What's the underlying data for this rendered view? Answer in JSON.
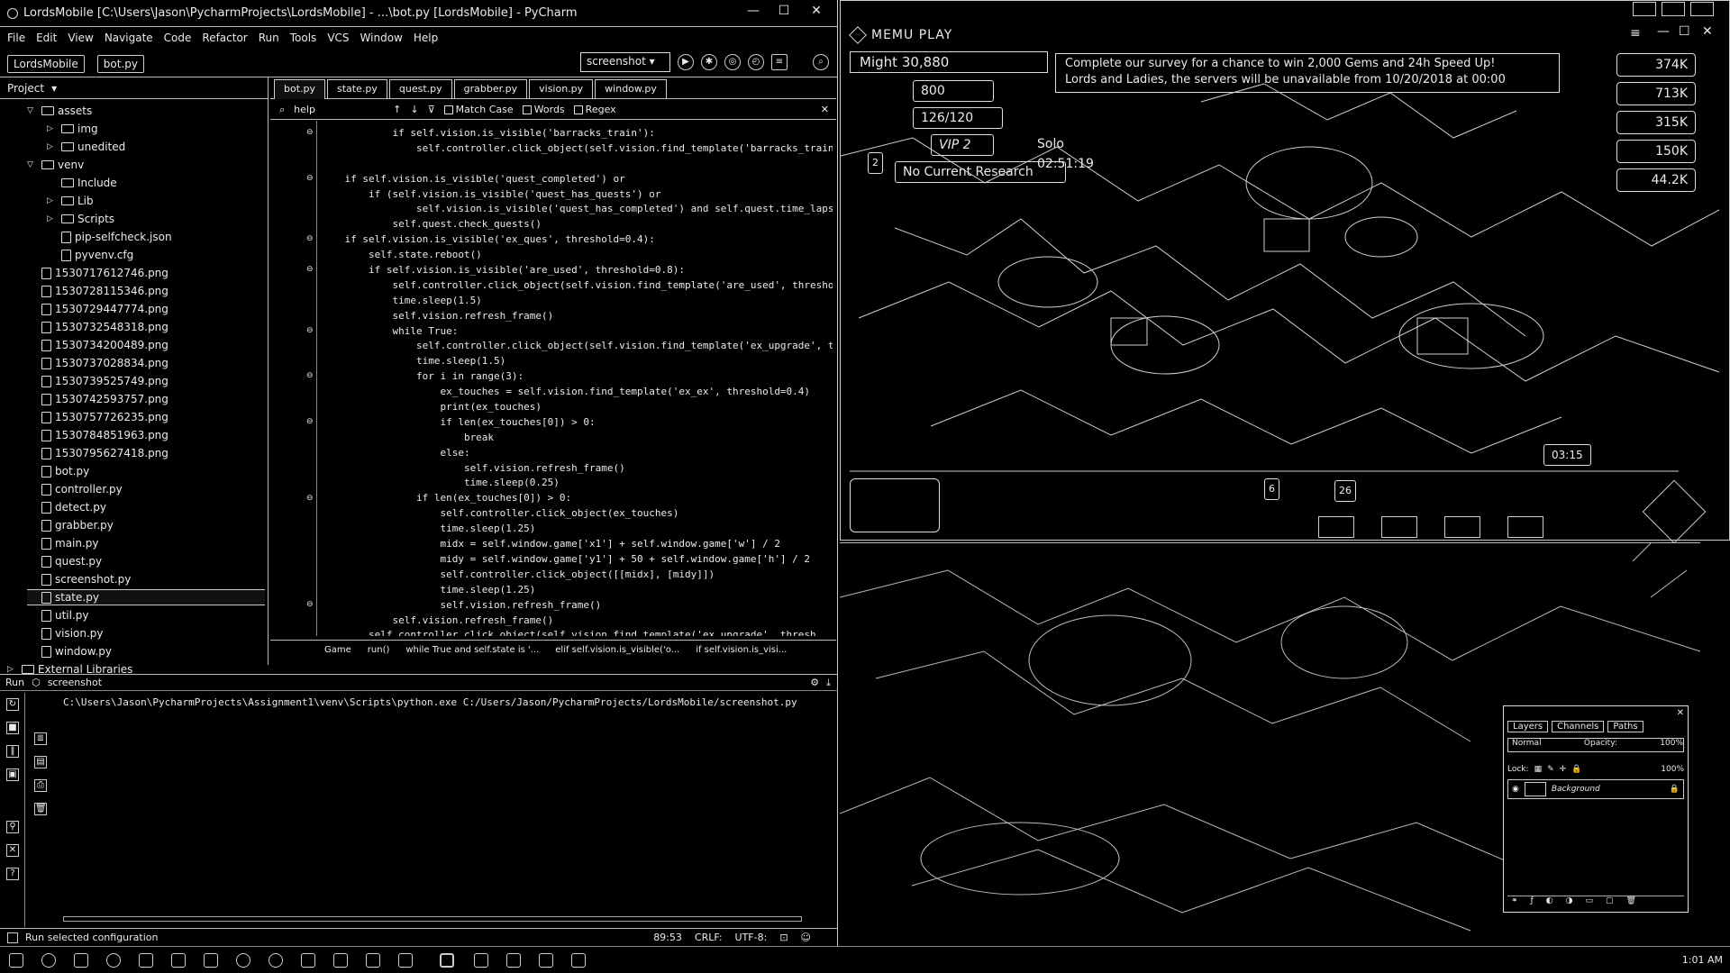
{
  "pycharm": {
    "title": "LordsMobile [C:\\Users\\Jason\\PycharmProjects\\LordsMobile] - ...\\bot.py [LordsMobile] - PyCharm",
    "menu": [
      "File",
      "Edit",
      "View",
      "Navigate",
      "Code",
      "Refactor",
      "Run",
      "Tools",
      "VCS",
      "Window",
      "Help"
    ],
    "breadcrumbs": [
      "LordsMobile",
      "bot.py"
    ],
    "run_config": "screenshot",
    "project_label": "Project",
    "tree": [
      {
        "label": "assets",
        "kind": "folder",
        "indent": 1,
        "arrow": "▽"
      },
      {
        "label": "img",
        "kind": "folder",
        "indent": 2,
        "arrow": "▷"
      },
      {
        "label": "unedited",
        "kind": "folder",
        "indent": 2,
        "arrow": "▷"
      },
      {
        "label": "venv",
        "kind": "folder",
        "indent": 1,
        "arrow": "▽"
      },
      {
        "label": "Include",
        "kind": "folder",
        "indent": 2,
        "arrow": ""
      },
      {
        "label": "Lib",
        "kind": "folder",
        "indent": 2,
        "arrow": "▷"
      },
      {
        "label": "Scripts",
        "kind": "folder",
        "indent": 2,
        "arrow": "▷"
      },
      {
        "label": "pip-selfcheck.json",
        "kind": "file",
        "indent": 2,
        "arrow": ""
      },
      {
        "label": "pyvenv.cfg",
        "kind": "file",
        "indent": 2,
        "arrow": ""
      },
      {
        "label": "1530717612746.png",
        "kind": "file",
        "indent": 1,
        "arrow": ""
      },
      {
        "label": "1530728115346.png",
        "kind": "file",
        "indent": 1,
        "arrow": ""
      },
      {
        "label": "1530729447774.png",
        "kind": "file",
        "indent": 1,
        "arrow": ""
      },
      {
        "label": "1530732548318.png",
        "kind": "file",
        "indent": 1,
        "arrow": ""
      },
      {
        "label": "1530734200489.png",
        "kind": "file",
        "indent": 1,
        "arrow": ""
      },
      {
        "label": "1530737028834.png",
        "kind": "file",
        "indent": 1,
        "arrow": ""
      },
      {
        "label": "1530739525749.png",
        "kind": "file",
        "indent": 1,
        "arrow": ""
      },
      {
        "label": "1530742593757.png",
        "kind": "file",
        "indent": 1,
        "arrow": ""
      },
      {
        "label": "1530757726235.png",
        "kind": "file",
        "indent": 1,
        "arrow": ""
      },
      {
        "label": "1530784851963.png",
        "kind": "file",
        "indent": 1,
        "arrow": ""
      },
      {
        "label": "1530795627418.png",
        "kind": "file",
        "indent": 1,
        "arrow": ""
      },
      {
        "label": "bot.py",
        "kind": "file",
        "indent": 1,
        "arrow": ""
      },
      {
        "label": "controller.py",
        "kind": "file",
        "indent": 1,
        "arrow": ""
      },
      {
        "label": "detect.py",
        "kind": "file",
        "indent": 1,
        "arrow": ""
      },
      {
        "label": "grabber.py",
        "kind": "file",
        "indent": 1,
        "arrow": ""
      },
      {
        "label": "main.py",
        "kind": "file",
        "indent": 1,
        "arrow": ""
      },
      {
        "label": "quest.py",
        "kind": "file",
        "indent": 1,
        "arrow": ""
      },
      {
        "label": "screenshot.py",
        "kind": "file",
        "indent": 1,
        "arrow": ""
      },
      {
        "label": "state.py",
        "kind": "file",
        "indent": 1,
        "arrow": ""
      },
      {
        "label": "util.py",
        "kind": "file",
        "indent": 1,
        "arrow": ""
      },
      {
        "label": "vision.py",
        "kind": "file",
        "indent": 1,
        "arrow": ""
      },
      {
        "label": "window.py",
        "kind": "file",
        "indent": 1,
        "arrow": ""
      },
      {
        "label": "External Libraries",
        "kind": "folder",
        "indent": 0,
        "arrow": "▷"
      }
    ],
    "tabs": [
      "bot.py",
      "state.py",
      "quest.py",
      "grabber.py",
      "vision.py",
      "window.py"
    ],
    "find_text": "help",
    "find_options": [
      "Match Case",
      "Words",
      "Regex"
    ],
    "code": [
      "            if self.vision.is_visible('barracks_train'):",
      "                self.controller.click_object(self.vision.find_template('barracks_train",
      "",
      "    if self.vision.is_visible('quest_completed') or",
      "        if (self.vision.is_visible('quest_has_quests') or",
      "                self.vision.is_visible('quest_has_completed') and self.quest.time_lapsed(",
      "            self.quest.check_quests()",
      "    if self.vision.is_visible('ex_ques', threshold=0.4):",
      "        self.state.reboot()",
      "        if self.vision.is_visible('are_used', threshold=0.8):",
      "            self.controller.click_object(self.vision.find_template('are_used', thresho",
      "            time.sleep(1.5)",
      "            self.vision.refresh_frame()",
      "            while True:",
      "                self.controller.click_object(self.vision.find_template('ex_upgrade', thr",
      "                time.sleep(1.5)",
      "                for i in range(3):",
      "                    ex_touches = self.vision.find_template('ex_ex', threshold=0.4)",
      "                    print(ex_touches)",
      "                    if len(ex_touches[0]) > 0:",
      "                        break",
      "                    else:",
      "                        self.vision.refresh_frame()",
      "                        time.sleep(0.25)",
      "                if len(ex_touches[0]) > 0:",
      "                    self.controller.click_object(ex_touches)",
      "                    time.sleep(1.25)",
      "                    midx = self.window.game['x1'] + self.window.game['w'] / 2",
      "                    midy = self.window.game['y1'] + 50 + self.window.game['h'] / 2",
      "                    self.controller.click_object([[midx], [midy]])",
      "                    time.sleep(1.25)",
      "                    self.vision.refresh_frame()",
      "            self.vision.refresh_frame()",
      "        self.controller.click_object(self.vision.find_template('ex_upgrade', thresh"
    ],
    "editor_breadcrumb": [
      "Game",
      "run()",
      "while True and self.state is '...",
      "elif self.vision.is_visible('o...",
      "if self.vision.is_visi..."
    ],
    "run_tab": "Run",
    "run_name": "screenshot",
    "run_output": "C:\\Users\\Jason\\PycharmProjects\\Assignment1\\venv\\Scripts\\python.exe C:/Users/Jason/PycharmProjects/LordsMobile/screenshot.py",
    "status_message": "Run selected configuration",
    "status_right": [
      "89:53",
      "CRLF:",
      "UTF-8:"
    ]
  },
  "memu": {
    "title": "MEMU PLAY",
    "might_label": "Might",
    "might_value": "30,880",
    "stamina": "800",
    "troops": "126/120",
    "vip": "VIP 2",
    "solo_timer": "Solo 02:51:19",
    "research": "No Current Research",
    "announcement_line1": "Complete our survey for a chance to win 2,000 Gems and 24h Speed Up!",
    "announcement_line2": "Lords and Ladies, the servers will be unavailable from 10/20/2018 at 00:00",
    "resources": [
      "374K",
      "713K",
      "315K",
      "150K",
      "44.2K"
    ],
    "badge_left": "2",
    "badge_mid": "6",
    "badge_mail": "26",
    "timer_right": "03:15"
  },
  "layers_panel": {
    "tabs": [
      "Layers",
      "Channels",
      "Paths"
    ],
    "blend": "Normal",
    "opacity_label": "Opacity:",
    "opacity": "100%",
    "lock_label": "Lock:",
    "fill": "100%",
    "layer_name": "Background"
  },
  "taskbar": {
    "clock": "1:01 AM"
  }
}
